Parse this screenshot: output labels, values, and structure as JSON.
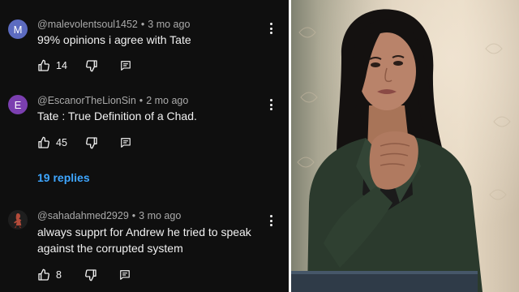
{
  "comments": [
    {
      "username": "@malevolentsoul1452",
      "time": "3 mo ago",
      "text": "99% opinions i agree with Tate",
      "likes": "14",
      "avatar_letter": "M",
      "avatar_color": "#5c6bc0"
    },
    {
      "username": "@EscanorTheLionSin",
      "time": "2 mo ago",
      "text": "Tate : True Definition of a Chad.",
      "likes": "45",
      "avatar_letter": "E",
      "avatar_color": "#7b3fb0"
    },
    {
      "username": "@sahadahmed2929",
      "time": "3 mo ago",
      "text": "always supprt for Andrew he  tried to speak against the corrupted system",
      "likes": "8",
      "avatar_letter": "",
      "avatar_color": "#1e1e1e"
    }
  ],
  "replies_link": "19 replies",
  "separator": "•",
  "colors": {
    "background": "#0f0f0f",
    "text": "#f1f1f1",
    "meta": "#aaaaaa",
    "link": "#3ea6ff"
  },
  "icons": [
    "thumbs-up-icon",
    "thumbs-down-icon",
    "reply-icon",
    "more-vert-icon"
  ]
}
